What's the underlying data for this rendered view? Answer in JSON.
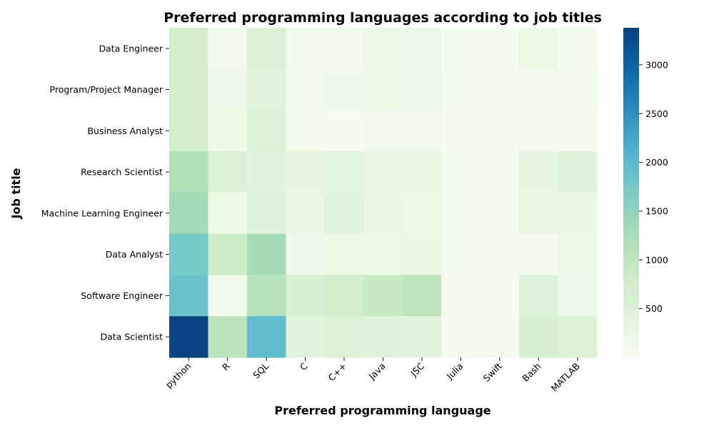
{
  "chart_data": {
    "type": "heatmap",
    "title": "Preferred programming languages according to job titles",
    "xlabel": "Preferred programming language",
    "ylabel": "Job title",
    "x_categories": [
      "python",
      "R",
      "SQL",
      "C",
      "C++",
      "Java",
      "JSC",
      "Julia",
      "Swift",
      "Bash",
      "MATLAB"
    ],
    "y_categories": [
      "Data Engineer",
      "Program/Project Manager",
      "Business Analyst",
      "Research Scientist",
      "Machine Learning Engineer",
      "Data Analyst",
      "Software Engineer",
      "Data Scientist"
    ],
    "values": [
      [
        700,
        120,
        520,
        80,
        100,
        180,
        150,
        20,
        10,
        180,
        40
      ],
      [
        700,
        150,
        380,
        120,
        140,
        180,
        170,
        30,
        25,
        90,
        70
      ],
      [
        720,
        180,
        500,
        60,
        40,
        110,
        100,
        10,
        10,
        50,
        30
      ],
      [
        1150,
        550,
        380,
        300,
        350,
        250,
        250,
        50,
        20,
        300,
        480
      ],
      [
        1320,
        160,
        480,
        250,
        380,
        250,
        200,
        50,
        30,
        250,
        250
      ],
      [
        1750,
        800,
        1300,
        150,
        200,
        200,
        250,
        30,
        30,
        100,
        200
      ],
      [
        1850,
        100,
        1100,
        600,
        700,
        900,
        1000,
        40,
        50,
        480,
        150
      ],
      [
        3350,
        1050,
        1950,
        420,
        500,
        450,
        400,
        40,
        20,
        620,
        500
      ]
    ],
    "colorscale": "GnBu",
    "vmin": 0,
    "vmax": 3380,
    "colorbar_ticks": [
      500,
      1000,
      1500,
      2000,
      2500,
      3000
    ],
    "colorbar_tick_labels": [
      "500",
      "1000",
      "1500",
      "2000",
      "2500",
      "3000"
    ],
    "grid": false
  }
}
